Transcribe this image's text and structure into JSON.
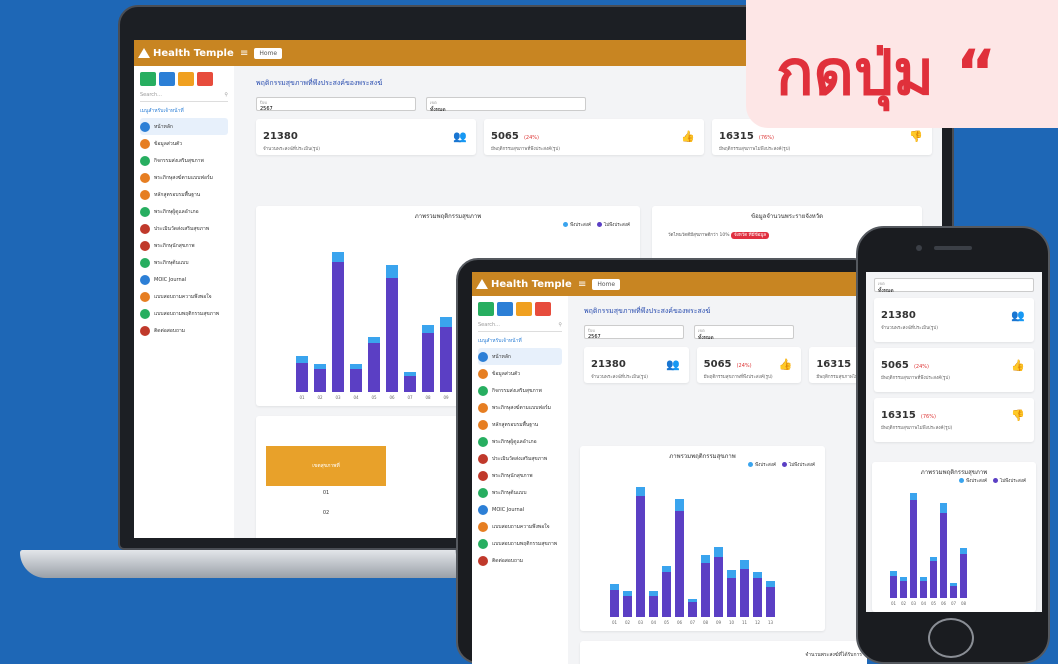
{
  "banner": {
    "text": "กดปุ่ม “"
  },
  "app": {
    "brand": "Health Temple",
    "home": "Home",
    "search_placeholder": "Search...",
    "menu_header": "เมนูสำหรับเจ้าหน้าที่",
    "menu": [
      {
        "label": "หน้าหลัก",
        "color": "#2c7fd6",
        "active": true
      },
      {
        "label": "ข้อมูลส่วนตัว",
        "color": "#e67e22"
      },
      {
        "label": "กิจกรรมส่งเสริมสุขภาพ",
        "color": "#27ae60"
      },
      {
        "label": "พระภิกษุสงฆ์ตามแบบฟอร์ม",
        "color": "#e67e22"
      },
      {
        "label": "หลักสูตรอบรมพื้นฐาน",
        "color": "#e67e22"
      },
      {
        "label": "พระภิกษุผู้ดูแลอำเภอ",
        "color": "#27ae60"
      },
      {
        "label": "ประเมินวัดส่งเสริมสุขภาพ",
        "color": "#c0392b"
      },
      {
        "label": "พระภิกษุนักสุขภาพ",
        "color": "#c0392b"
      },
      {
        "label": "พระภิกษุต้นแบบ",
        "color": "#27ae60"
      },
      {
        "label": "MOIC Journal",
        "color": "#2c7fd6"
      },
      {
        "label": "แบบสอบถามความพึงพอใจ",
        "color": "#e67e22"
      },
      {
        "label": "แบบสอบถามพฤติกรรมสุขภาพ",
        "color": "#27ae60"
      },
      {
        "label": "ติดต่อสอบถาม",
        "color": "#c0392b"
      }
    ],
    "page_title": "พฤติกรรมสุขภาพที่พึงประสงค์ของพระสงฆ์",
    "year_label": "ปีงบ",
    "year_value": "2567",
    "area_label": "เขต",
    "area_value": "ทั้งหมด",
    "cards": [
      {
        "num": "21380",
        "pct": "",
        "label": "จำนวนพระสงฆ์ที่ประเมิน(รูป)",
        "icon": "👥",
        "icon_name": "users-icon"
      },
      {
        "num": "5065",
        "pct": "(24%)",
        "label": "มีพฤติกรรมสุขภาพที่พึงประสงค์(รูป)",
        "icon": "👍",
        "icon_name": "thumbs-up-icon"
      },
      {
        "num": "16315",
        "pct": "(76%)",
        "label": "มีพฤติกรรมสุขภาพไม่พึงประสงค์(รูป)",
        "icon": "👎",
        "icon_name": "thumbs-down-icon"
      }
    ],
    "chart_title": "ภาพรวมพฤติกรรมสุขภาพ",
    "legend": [
      "พึงประสงค์",
      "ไม่พึงประสงค์"
    ],
    "right_panel_title": "ข้อมูลจำนวนพระรายจังหวัด",
    "right_panel_line": "วัดไหนวัดดีมีสุขภาพดีกว่า 10%",
    "right_panel_badge": "จังหวัด ที่มีข้อมูล",
    "table_header": [
      "เขตสุขภาพที่"
    ],
    "table_rows": [
      "01",
      "02"
    ],
    "tablet_bottom_label": "จำนวนพระสงฆ์ที่ได้รับการ"
  },
  "chart_data": {
    "type": "bar",
    "title": "ภาพรวมพฤติกรรมสุขภาพ",
    "categories": [
      "01",
      "02",
      "03",
      "04",
      "05",
      "06",
      "07",
      "08",
      "09",
      "10",
      "11",
      "12",
      "13"
    ],
    "series": [
      {
        "name": "พึงประสงค์",
        "values": [
          200,
          150,
          300,
          150,
          200,
          400,
          100,
          250,
          300,
          250,
          300,
          200,
          200
        ]
      },
      {
        "name": "ไม่พึงประสงค์",
        "values": [
          900,
          700,
          4000,
          700,
          1500,
          3500,
          500,
          1800,
          2000,
          1300,
          1600,
          1300,
          1000
        ]
      }
    ],
    "colors": [
      "#3aa4ee",
      "#5b3fc4"
    ]
  }
}
